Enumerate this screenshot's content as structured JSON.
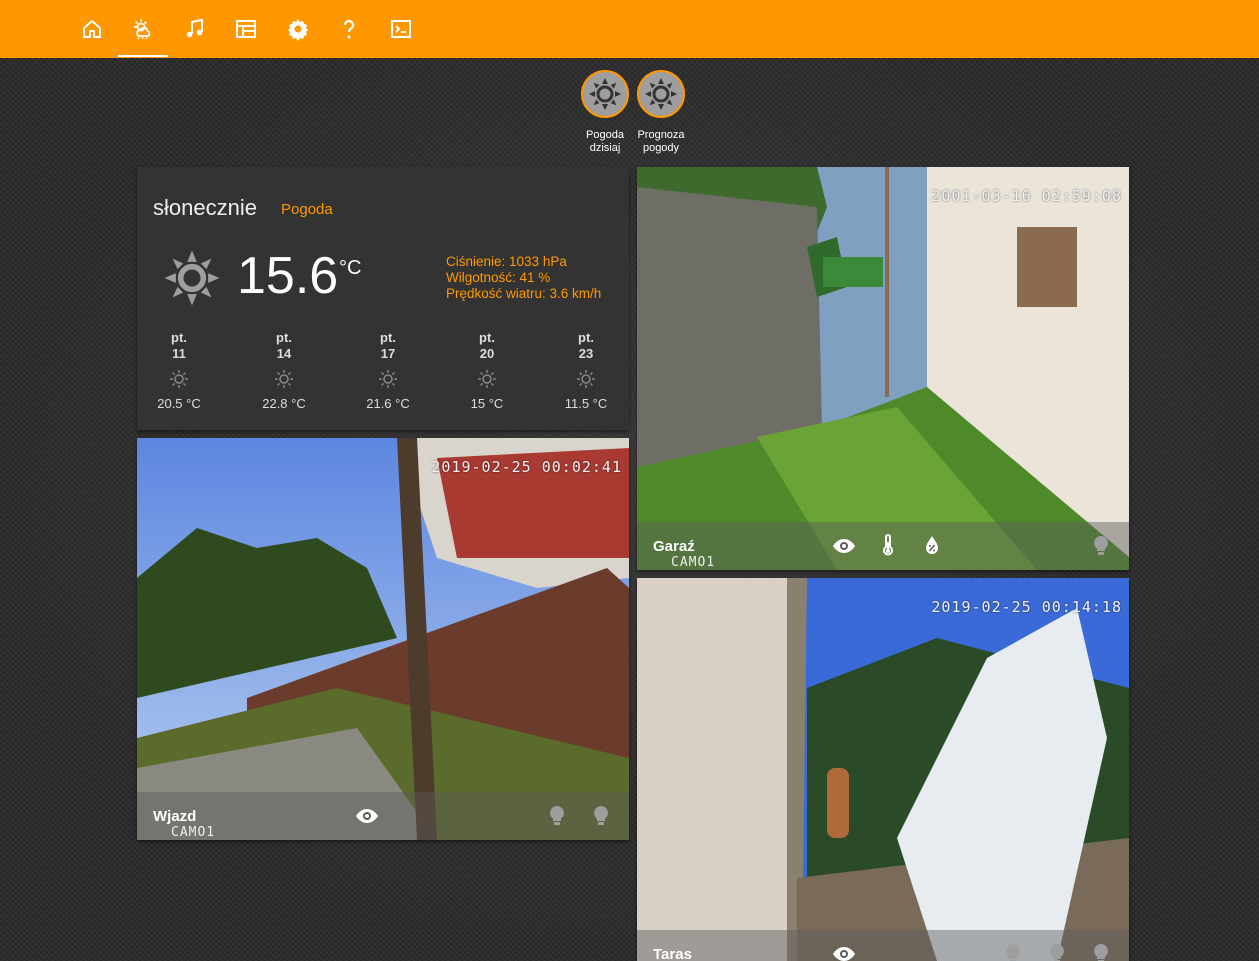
{
  "nav": {
    "tabs": [
      {
        "icon": "home-icon",
        "active": false
      },
      {
        "icon": "weather-icon",
        "active": true
      },
      {
        "icon": "music-icon",
        "active": false
      },
      {
        "icon": "schedule-icon",
        "active": false
      },
      {
        "icon": "gear-icon",
        "active": false
      },
      {
        "icon": "help-icon",
        "active": false
      },
      {
        "icon": "terminal-icon",
        "active": false
      }
    ],
    "accent": "#ff9800"
  },
  "scenes": {
    "today": {
      "line1": "Pogoda",
      "line2": "dzisiaj"
    },
    "forecast": {
      "line1": "Prognoza",
      "line2": "pogody"
    }
  },
  "weather": {
    "condition": "słonecznie",
    "label": "Pogoda",
    "temp": "15.6",
    "unit": "°C",
    "pressure": "Ciśnienie: 1033 hPa",
    "humidity": "Wilgotność: 41 %",
    "wind": "Prędkość wiatru: 3.6 km/h",
    "forecast": [
      {
        "day": "pt.",
        "date": "11",
        "temp": "20.5 °C"
      },
      {
        "day": "pt.",
        "date": "14",
        "temp": "22.8 °C"
      },
      {
        "day": "pt.",
        "date": "17",
        "temp": "21.6 °C"
      },
      {
        "day": "pt.",
        "date": "20",
        "temp": "15 °C"
      },
      {
        "day": "pt.",
        "date": "23",
        "temp": "11.5 °C"
      }
    ]
  },
  "cameras": {
    "wjazd": {
      "name": "Wjazd",
      "timestamp": "2019-02-25 00:02:41",
      "camid": "CAMO1"
    },
    "garaz": {
      "name": "Garaź",
      "timestamp": "2001-03-16 02:59:08",
      "camid": "CAMO1"
    },
    "taras": {
      "name": "Taras",
      "timestamp": "2019-02-25 00:14:18",
      "camid": ""
    }
  }
}
